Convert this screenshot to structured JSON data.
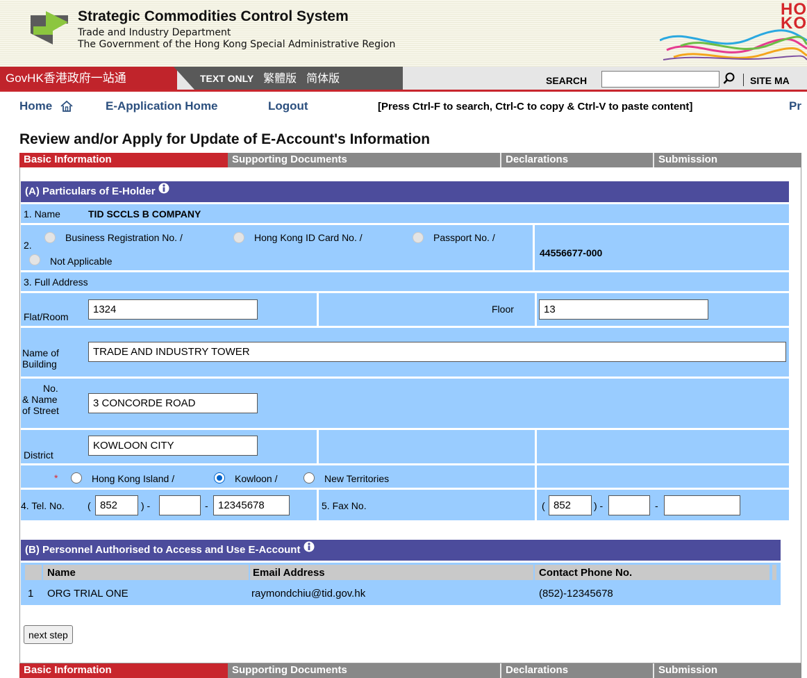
{
  "header": {
    "system_title": "Strategic Commodities Control System",
    "department": "Trade and Industry Department",
    "government": "The Government of the Hong Kong Special Administrative Region",
    "brand_text": "HO KO",
    "brand_line1": "HO",
    "brand_line2": "KO"
  },
  "govbar": {
    "govhk_label": "GovHK",
    "govhk_chinese": "香港政府一站通",
    "text_only": "TEXT ONLY",
    "traditional": "繁體版",
    "simplified": "简体版",
    "search_label": "SEARCH",
    "search_value": "",
    "site_map": "SITE MA"
  },
  "nav": {
    "home": "Home",
    "e_application_home": "E-Application Home",
    "logout": "Logout",
    "hint": "[Press Ctrl-F to search, Ctrl-C to copy & Ctrl-V to paste content]",
    "print": "Pr"
  },
  "page": {
    "title": "Review and/or Apply for Update of E-Account's Information"
  },
  "steps": [
    {
      "label": "Basic Information",
      "active": true
    },
    {
      "label": "Supporting Documents",
      "active": false
    },
    {
      "label": "Declarations",
      "active": false
    },
    {
      "label": "Submission",
      "active": false
    }
  ],
  "section_a": {
    "title": "(A) Particulars of E-Holder",
    "name_label": "1. Name",
    "name_value": "TID SCCLS B COMPANY",
    "id_label": "2.",
    "id_options": [
      "Business Registration No. /",
      "Hong Kong ID Card No. /",
      "Passport No. /",
      "Not Applicable"
    ],
    "id_value": "44556677-000",
    "address_label": "3. Full Address",
    "flat_label": "Flat/Room",
    "flat_value": "1324",
    "floor_label": "Floor",
    "floor_value": "13",
    "building_label_1": "Name of",
    "building_label_2": "Building",
    "building_value": "TRADE AND INDUSTRY TOWER",
    "street_label_1": "No.",
    "street_label_2": "& Name",
    "street_label_3": "of Street",
    "street_value": "3 CONCORDE ROAD",
    "district_label": "District",
    "district_value": "KOWLOON CITY",
    "required_mark": "*",
    "region_options": [
      "Hong Kong Island /",
      "Kowloon /",
      "New Territories"
    ],
    "region_selected": "Kowloon",
    "tel_label": "4. Tel. No.",
    "tel_country": "852",
    "tel_area": "",
    "tel_number": "12345678",
    "fax_label": "5. Fax No.",
    "fax_country": "852",
    "fax_area": "",
    "fax_number": "",
    "paren_open": "(",
    "paren_close_dash": ") -",
    "dash": "-"
  },
  "section_b": {
    "title": "(B) Personnel Authorised to Access and Use E-Account",
    "columns": [
      "Name",
      "Email Address",
      "Contact Phone No."
    ],
    "rows": [
      {
        "no": "1",
        "name": "ORG TRIAL ONE",
        "email": "raymondchiu@tid.gov.hk",
        "phone": "(852)-12345678"
      }
    ]
  },
  "actions": {
    "next_step": "next step"
  },
  "colors": {
    "brand_red": "#c8262d",
    "section_header": "#4c4c9c",
    "form_cell": "#99ccff",
    "link": "#2b4f7e"
  }
}
